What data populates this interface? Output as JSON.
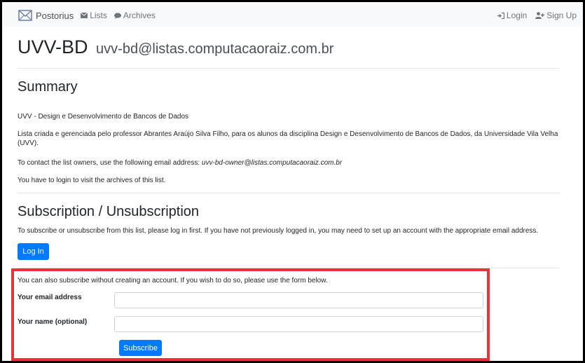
{
  "navbar": {
    "brand": "Postorius",
    "lists": "Lists",
    "archives": "Archives",
    "login": "Login",
    "signup": "Sign Up"
  },
  "list": {
    "name": "UVV-BD",
    "address": "uvv-bd@listas.computacaoraiz.com.br"
  },
  "summary": {
    "heading": "Summary",
    "display_name": "UVV - Design e Desenvolvimento de Bancos de Dados",
    "description": "Lista criada e gerenciada pelo professor Abrantes Araújo Silva Filho, para os alunos da disciplina Design e Desenvolvimento de Bancos de Dados, da Universidade Vila Velha (UVV).",
    "contact_prefix": "To contact the list owners, use the following email address: ",
    "owner_email": "uvv-bd-owner@listas.computacaoraiz.com.br",
    "archives_note": "You have to login to visit the archives of this list."
  },
  "subscription": {
    "heading": "Subscription / Unsubscription",
    "intro": "To subscribe or unsubscribe from this list, please log in first. If you have not previously logged in, you may need to set up an account with the appropriate email address.",
    "login_button": "Log In",
    "anon_intro": "You can also subscribe without creating an account. If you wish to do so, please use the form below.",
    "email_label": "Your email address",
    "email_value": "",
    "name_label": "Your name (optional)",
    "name_value": "",
    "subscribe_button": "Subscribe"
  },
  "colors": {
    "primary": "#007bff",
    "highlight": "#e8323c",
    "navbar_bg": "#f8f9fa"
  }
}
